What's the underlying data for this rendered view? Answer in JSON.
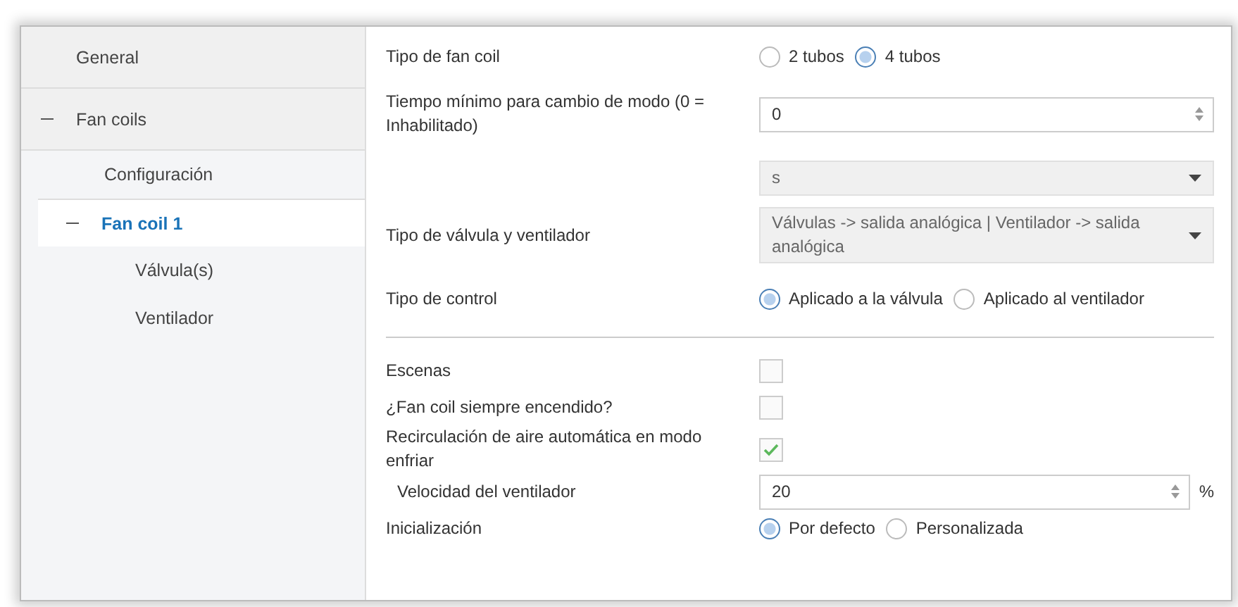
{
  "sidebar": {
    "items": [
      {
        "label": "General",
        "selected": false
      },
      {
        "label": "Fan coils",
        "selected": false,
        "expanded": true,
        "children": [
          {
            "label": "Configuración",
            "selected": false
          },
          {
            "label": "Fan coil 1",
            "selected": true,
            "expanded": true,
            "children": [
              {
                "label": "Válvula(s)",
                "selected": false
              },
              {
                "label": "Ventilador",
                "selected": false
              }
            ]
          }
        ]
      }
    ]
  },
  "rows": [
    {
      "kind": "radio",
      "label": "Tipo de fan coil",
      "options": [
        {
          "label": "2 tubos",
          "selected": false
        },
        {
          "label": "4 tubos",
          "selected": true
        }
      ]
    },
    {
      "kind": "spin",
      "label": "Tiempo mínimo para cambio de modo (0 = Inhabilitado)",
      "value": "0"
    },
    {
      "kind": "select",
      "value": "s"
    },
    {
      "kind": "select",
      "label": "Tipo de válvula y ventilador",
      "value": "Válvulas -> salida analógica | Ventilador -> salida analógica"
    },
    {
      "kind": "radio",
      "label": "Tipo de control",
      "options": [
        {
          "label": "Aplicado a la válvula",
          "selected": true
        },
        {
          "label": "Aplicado al ventilador",
          "selected": false
        }
      ]
    },
    {
      "kind": "divider"
    },
    {
      "kind": "checkbox",
      "label": "Escenas",
      "checked": false
    },
    {
      "kind": "checkbox",
      "label": "¿Fan coil siempre encendido?",
      "checked": false
    },
    {
      "kind": "checkbox",
      "label": "Recirculación de aire automática en modo enfriar",
      "checked": true,
      "children": [
        {
          "kind": "spin",
          "label": "Velocidad del ventilador",
          "value": "20",
          "unit": "%"
        }
      ]
    },
    {
      "kind": "radio",
      "label": "Inicialización",
      "options": [
        {
          "label": "Por defecto",
          "selected": true
        },
        {
          "label": "Personalizada",
          "selected": false
        }
      ]
    }
  ]
}
